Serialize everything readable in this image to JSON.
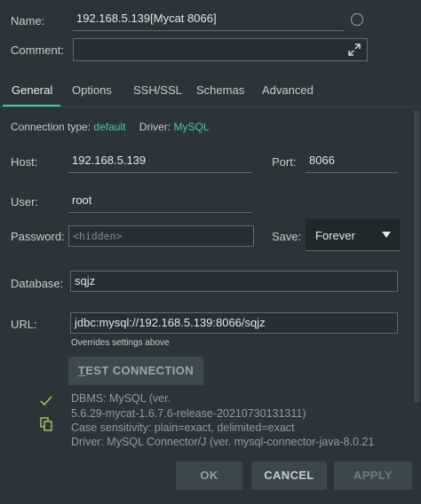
{
  "header": {
    "name_label": "Name:",
    "name_value": "192.168.5.139[Mycat 8066]",
    "comment_label": "Comment:",
    "comment_value": "",
    "expand_icon": "expand-icon",
    "color_icon": "color-circle-icon"
  },
  "tabs": [
    {
      "label": "General",
      "active": true
    },
    {
      "label": "Options",
      "active": false
    },
    {
      "label": "SSH/SSL",
      "active": false
    },
    {
      "label": "Schemas",
      "active": false
    },
    {
      "label": "Advanced",
      "active": false
    }
  ],
  "connection": {
    "type_label": "Connection type:",
    "type_value": "default",
    "driver_label": "Driver:",
    "driver_value": "MySQL"
  },
  "form": {
    "host_label": "Host:",
    "host_value": "192.168.5.139",
    "port_label": "Port:",
    "port_value": "8066",
    "user_label": "User:",
    "user_value": "root",
    "password_label": "Password:",
    "password_placeholder": "<hidden>",
    "save_label": "Save:",
    "save_value": "Forever",
    "database_label": "Database:",
    "database_value": "sqjz",
    "url_label": "URL:",
    "url_value": "jdbc:mysql://192.168.5.139:8066/sqjz",
    "url_hint": "Overrides settings above"
  },
  "test_button": {
    "label_first": "T",
    "label_rest": "EST CONNECTION"
  },
  "info": {
    "lines": [
      "DBMS: MySQL (ver.",
      "5.6.29-mycat-1.6.7.6-release-20210730131311)",
      "Case sensitivity: plain=exact, delimited=exact",
      "Driver: MySQL Connector/J (ver. mysql-connector-java-8.0.21"
    ],
    "icons": [
      "check-icon",
      "copy-icon"
    ]
  },
  "footer": {
    "ok_label": "OK",
    "cancel_label": "CANCEL",
    "apply_label": "APPLY"
  },
  "colors": {
    "background": "#2b3539",
    "accent": "#4fc2b8",
    "check": "#a8c85a"
  }
}
